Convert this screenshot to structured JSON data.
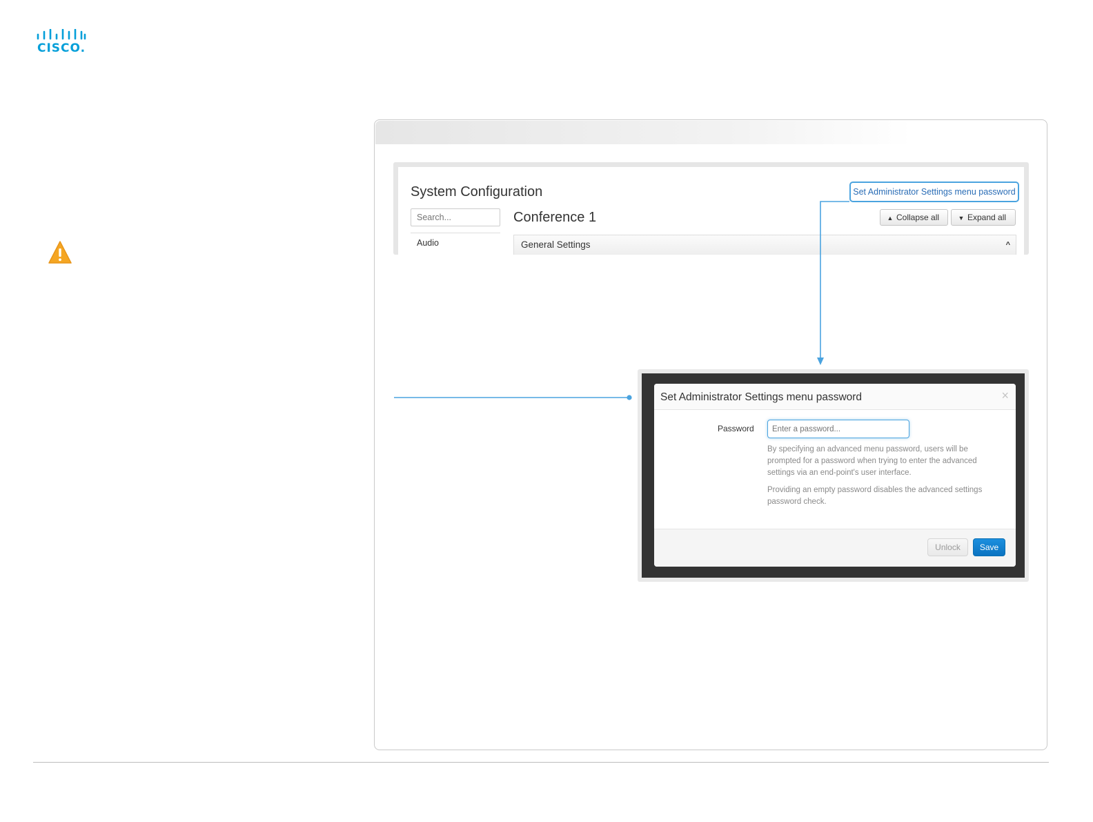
{
  "logo": {
    "text": "CISCO.",
    "color": "#049fd9"
  },
  "warning": {
    "icon": "warning-triangle-icon",
    "color": "#f5a623"
  },
  "system_config": {
    "title": "System Configuration",
    "admin_link": "Set Administrator Settings menu password",
    "search_placeholder": "Search...",
    "nav_items": [
      "Audio"
    ],
    "section_title": "Conference 1",
    "collapse_label": "Collapse all",
    "expand_label": "Expand all",
    "general_settings": "General Settings"
  },
  "modal": {
    "title": "Set Administrator Settings menu password",
    "close": "×",
    "password_label": "Password",
    "password_placeholder": "Enter a password...",
    "help_text_1": "By specifying an advanced menu password, users will be prompted for a password when trying to enter the advanced settings via an end-point's user interface.",
    "help_text_2": "Providing an empty password disables the advanced settings password check.",
    "unlock_label": "Unlock",
    "save_label": "Save"
  },
  "colors": {
    "accent": "#4aa3df",
    "link": "#2a6db6",
    "primary_button": "#0b73c1"
  }
}
